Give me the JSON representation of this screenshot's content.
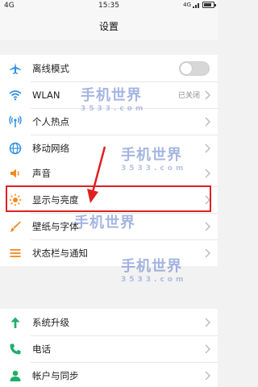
{
  "status_bar": {
    "left": "4G",
    "time": "15:35",
    "right": "4G"
  },
  "title": "设置",
  "groups": [
    {
      "items": [
        {
          "label": "离线模式",
          "icon": "airplane-icon",
          "control": "toggle",
          "toggle_on": false
        },
        {
          "label": "WLAN",
          "icon": "wifi-icon",
          "value": "已关闭"
        },
        {
          "label": "个人热点",
          "icon": "hotspot-icon"
        },
        {
          "label": "移动网络",
          "icon": "globe-icon"
        }
      ]
    },
    {
      "items": [
        {
          "label": "声音",
          "icon": "speaker-icon"
        },
        {
          "label": "显示与亮度",
          "icon": "brightness-icon"
        },
        {
          "label": "壁纸与字体",
          "icon": "brush-icon"
        },
        {
          "label": "状态栏与通知",
          "icon": "list-icon"
        }
      ]
    },
    {
      "items": [
        {
          "label": "系统升级",
          "icon": "arrow-up-icon"
        },
        {
          "label": "电话",
          "icon": "phone-icon"
        },
        {
          "label": "帐户与同步",
          "icon": "account-icon"
        }
      ]
    }
  ],
  "watermark": {
    "title": "手机世界",
    "sub": "3533.com"
  },
  "colors": {
    "accent_blue": "#2f8fe0",
    "highlight_red": "#e02020",
    "airplane": "#2f8fe0",
    "wifi": "#2f8fe0",
    "hotspot": "#2f8fe0",
    "globe": "#2f8fe0",
    "speaker": "#f08a1e",
    "brightness": "#f08a1e",
    "brush": "#f08a1e",
    "list": "#f08a1e",
    "arrow_up": "#1fae6a",
    "phone": "#1fae6a",
    "account": "#1fae6a"
  }
}
